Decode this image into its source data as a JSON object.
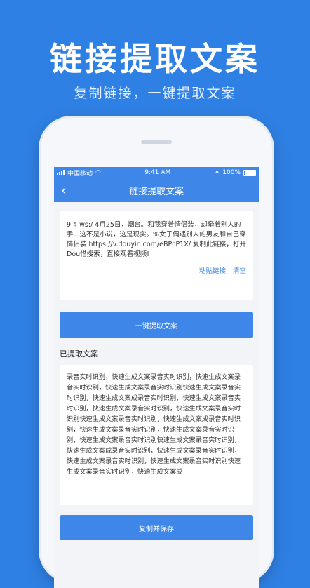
{
  "promo": {
    "title": "链接提取文案",
    "subtitle": "复制链接，一键提取文案"
  },
  "status_bar": {
    "carrier": "中国移动",
    "time": "9:41 AM",
    "battery": "100%"
  },
  "nav": {
    "title": "链接提取文案"
  },
  "input_card": {
    "text": "9.4 ws:/ 4月25日，烟台。和我穿着情侣装，却牵着别人的手...这不是小说，这是现实。%女子偶遇别人的男友和自己穿情侣装 https://v.douyin.com/eBPcP1X/ 复制此链接，打开Dou惜搜索，直接观看视频!",
    "paste_label": "粘贴链接",
    "clear_label": "清空"
  },
  "extract_button": "一键提取文案",
  "result": {
    "heading": "已提取文案",
    "text": "录音实时识别，快速生成文案录音实时识别，快速生成文案录音实时识别，快速生成文案录音实时识别快速生成文案录音实时识别，快速生成文案成录音实时识别，快速生成文案录音实时识别，快速生成文案录音实时识别，快速生成文案录音实时识别快速生成文案录音实时识别，快速生成文案成录音实时识别，快速生成文案录音实时识别，快速生成文案录音实时识别，快速生成文案录音实时识别快速生成文案录音实时识别，快速生成文案成录音实时识别，快速生成文案录音实时识别，快速生成文案录音实时识别，快速生成文案录音实时识别快速生成文案录音实时识别，快速生成文案成"
  },
  "save_button": "复制并保存",
  "colors": {
    "background": "#2f80e4",
    "accent": "#3e86e8"
  }
}
